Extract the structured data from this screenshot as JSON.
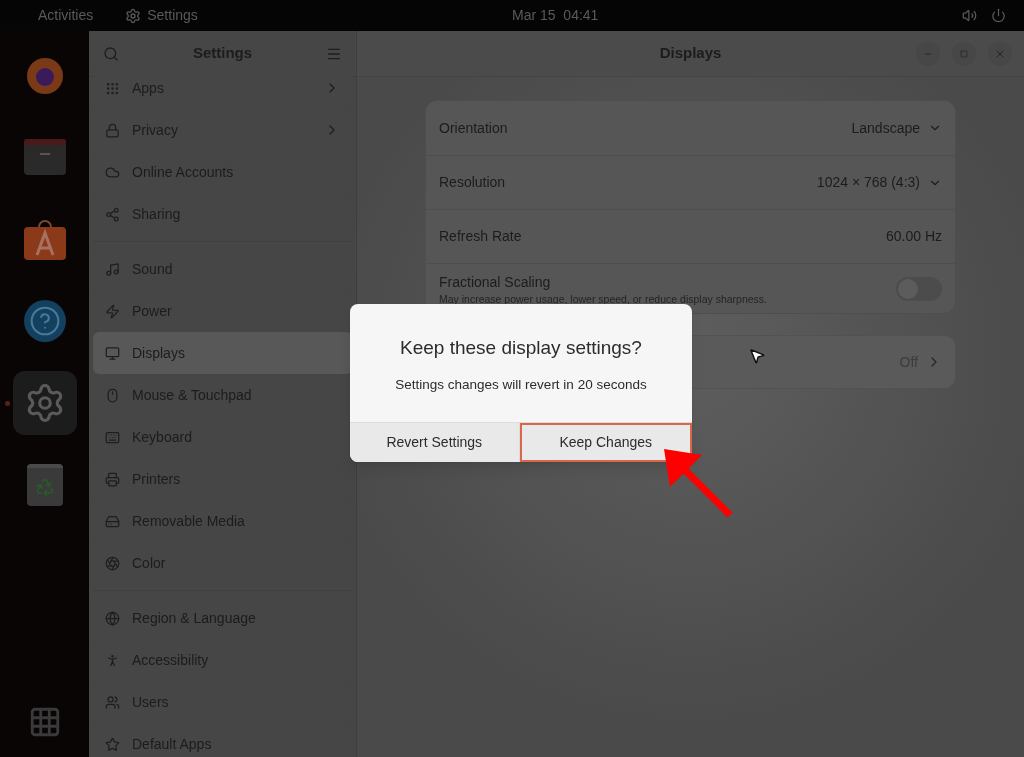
{
  "top_bar": {
    "activities": "Activities",
    "app_name": "Settings",
    "clock": "Mar 15  04:41"
  },
  "dock": [
    {
      "kind": "browser",
      "selected": false
    },
    {
      "kind": "files",
      "selected": false
    },
    {
      "kind": "store",
      "selected": false
    },
    {
      "kind": "help",
      "selected": false
    },
    {
      "kind": "settings",
      "selected": true
    },
    {
      "kind": "trash",
      "selected": false
    }
  ],
  "sidebar": {
    "title": "Settings",
    "groups": [
      [
        {
          "label": "Apps",
          "selected": false,
          "chevron": true
        },
        {
          "label": "Privacy",
          "selected": false,
          "chevron": true
        },
        {
          "label": "Online Accounts",
          "selected": false,
          "chevron": false
        },
        {
          "label": "Sharing",
          "selected": false,
          "chevron": false
        }
      ],
      [
        {
          "label": "Sound",
          "selected": false,
          "chevron": false
        },
        {
          "label": "Power",
          "selected": false,
          "chevron": false
        },
        {
          "label": "Displays",
          "selected": true,
          "chevron": false
        },
        {
          "label": "Mouse & Touchpad",
          "selected": false,
          "chevron": false
        },
        {
          "label": "Keyboard",
          "selected": false,
          "chevron": false
        },
        {
          "label": "Printers",
          "selected": false,
          "chevron": false
        },
        {
          "label": "Removable Media",
          "selected": false,
          "chevron": false
        },
        {
          "label": "Color",
          "selected": false,
          "chevron": false
        }
      ],
      [
        {
          "label": "Region & Language",
          "selected": false,
          "chevron": false
        },
        {
          "label": "Accessibility",
          "selected": false,
          "chevron": false
        },
        {
          "label": "Users",
          "selected": false,
          "chevron": false
        },
        {
          "label": "Default Apps",
          "selected": false,
          "chevron": false
        }
      ]
    ]
  },
  "main": {
    "title": "Displays",
    "settings": [
      {
        "kind": "dropdown",
        "label": "Orientation",
        "value": "Landscape"
      },
      {
        "kind": "dropdown",
        "label": "Resolution",
        "value": "1024 × 768 (4:3)"
      },
      {
        "kind": "text",
        "label": "Refresh Rate",
        "value": "60.00 Hz"
      },
      {
        "kind": "switch",
        "label": "Fractional Scaling",
        "description": "May increase power usage, lower speed, or reduce display sharpness.",
        "on": false
      }
    ],
    "night_light": {
      "value": "Off"
    }
  },
  "dialog": {
    "title": "Keep these display settings?",
    "message": "Settings changes will revert in 20 seconds",
    "buttons": [
      {
        "label": "Revert Settings",
        "highlighted": false
      },
      {
        "label": "Keep Changes",
        "highlighted": true
      }
    ]
  }
}
